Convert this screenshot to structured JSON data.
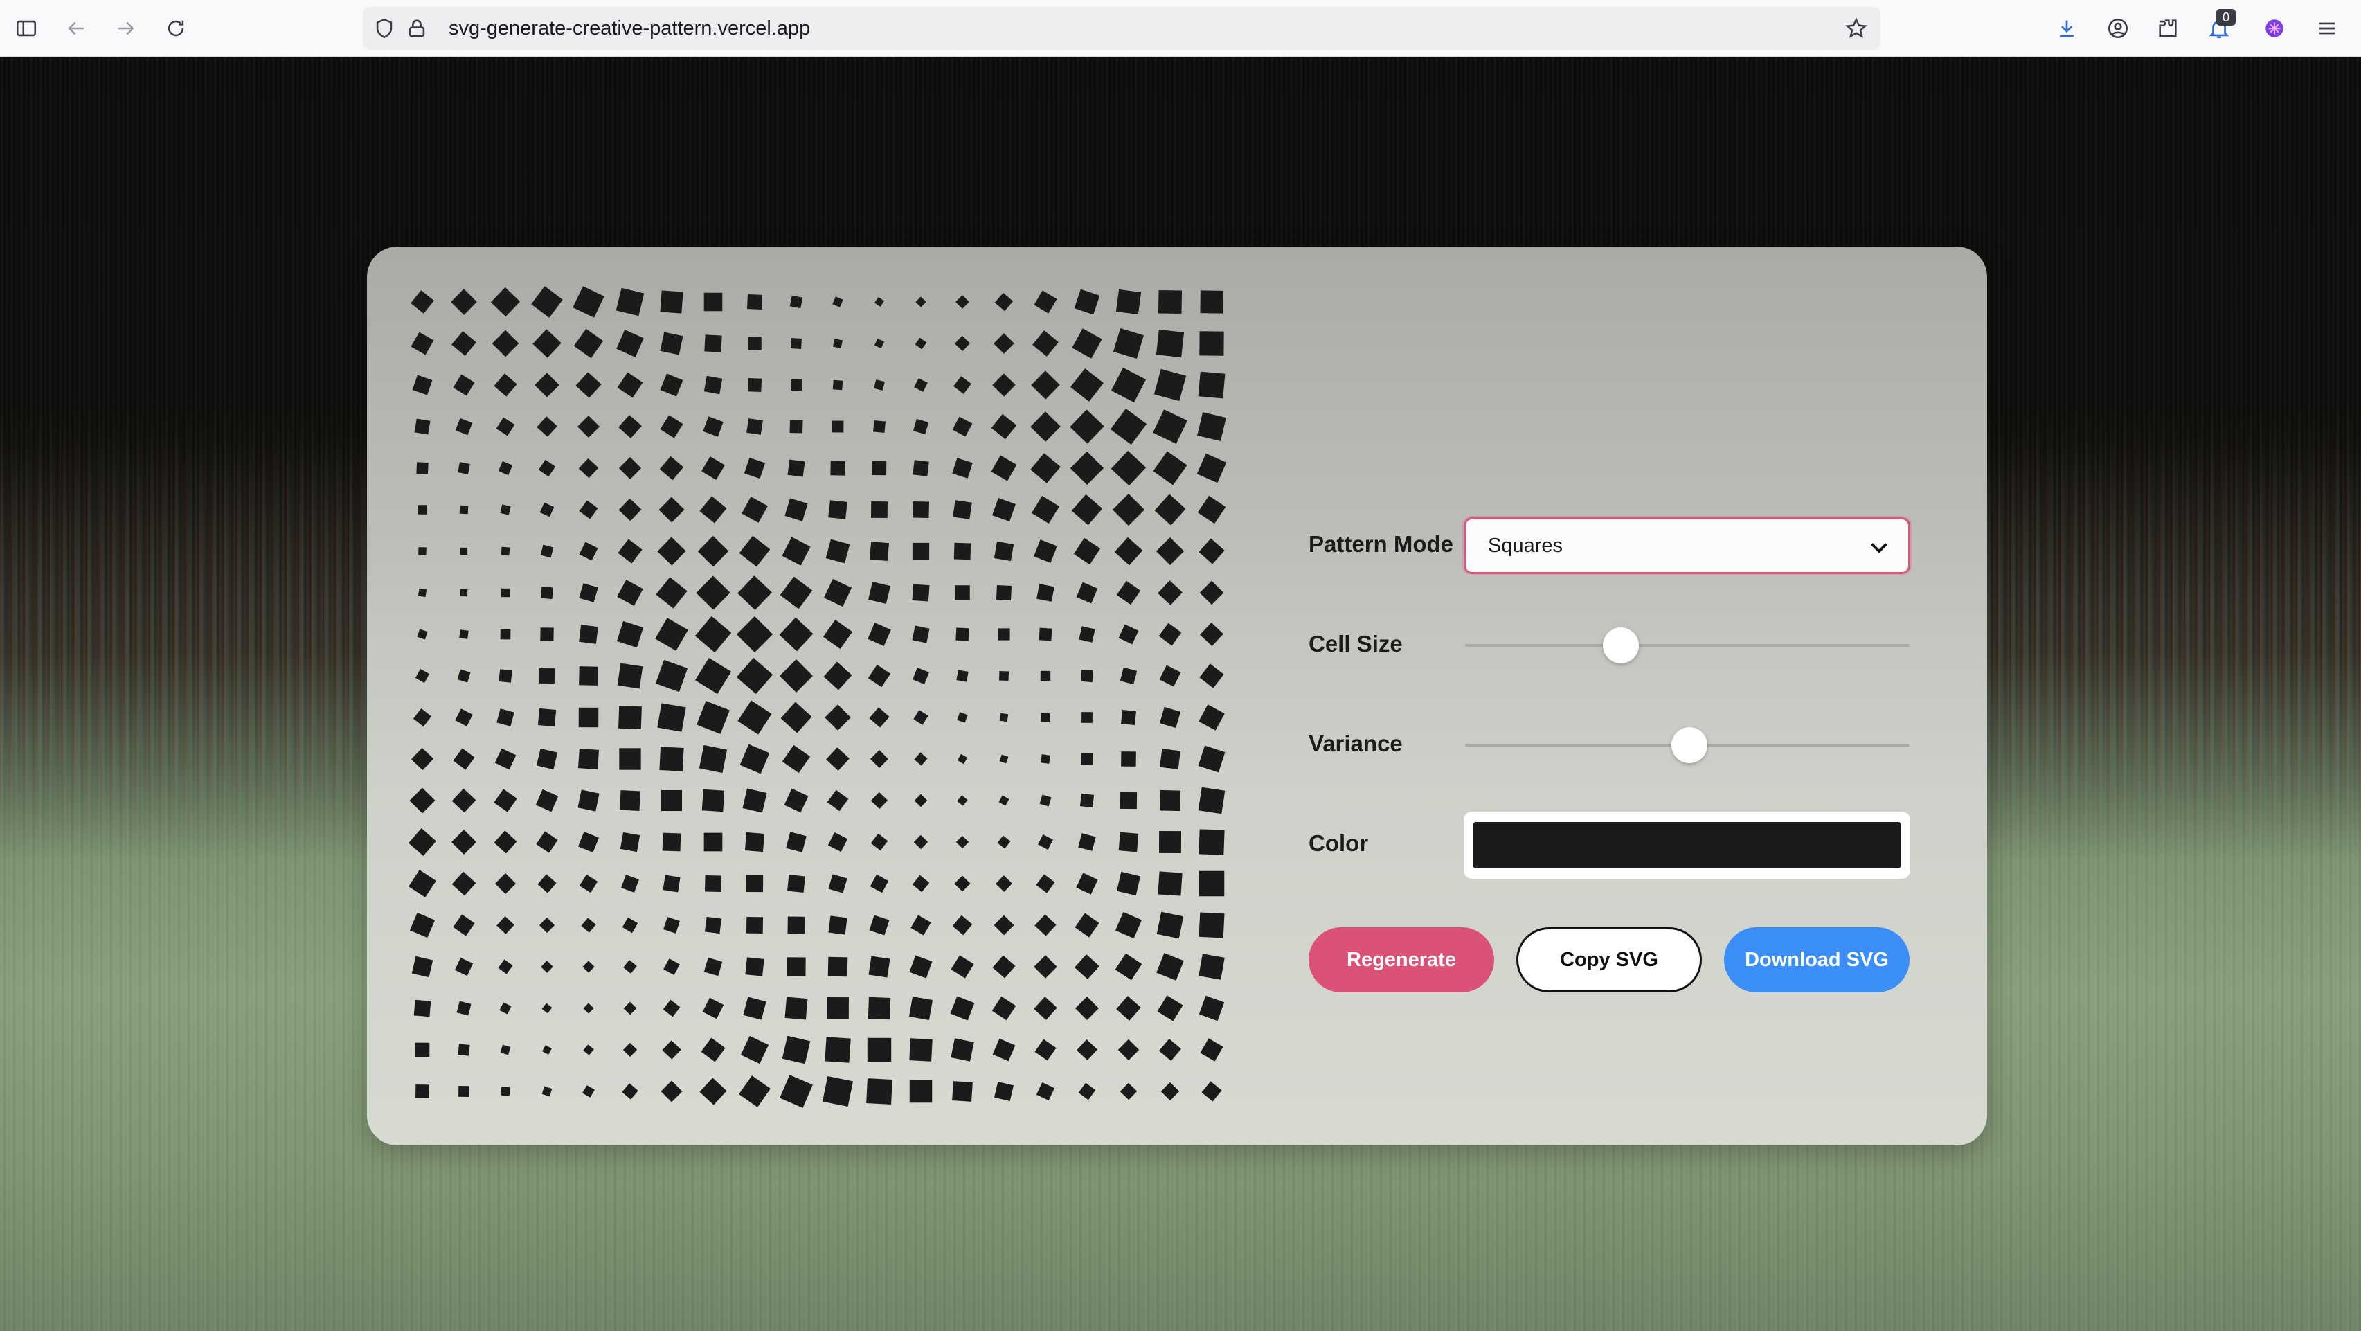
{
  "browser": {
    "url": "svg-generate-creative-pattern.vercel.app",
    "notification_count": "0",
    "icons": [
      "sidebar-toggle-icon",
      "back-arrow-icon",
      "forward-arrow-icon",
      "reload-icon",
      "shield-icon",
      "lock-icon",
      "bookmark-star-icon",
      "download-icon",
      "account-icon",
      "extensions-icon",
      "notifications-icon",
      "extension-flower-icon",
      "menu-icon"
    ]
  },
  "controls": {
    "pattern_mode_label": "Pattern Mode",
    "pattern_mode_value": "Squares",
    "cell_size_label": "Cell Size",
    "cell_size_fraction": 0.35,
    "variance_label": "Variance",
    "variance_fraction": 0.505,
    "color_label": "Color",
    "color_value": "#1b1b1b",
    "regenerate_label": "Regenerate",
    "copy_label": "Copy SVG",
    "download_label": "Download SVG"
  },
  "colors": {
    "regenerate": "#db5277",
    "download": "#3b8ef5",
    "select_border": "#d9587e",
    "pattern_fill": "#1b1b1b"
  },
  "pattern": {
    "mode": "Squares",
    "columns": 20,
    "rows": 20
  }
}
